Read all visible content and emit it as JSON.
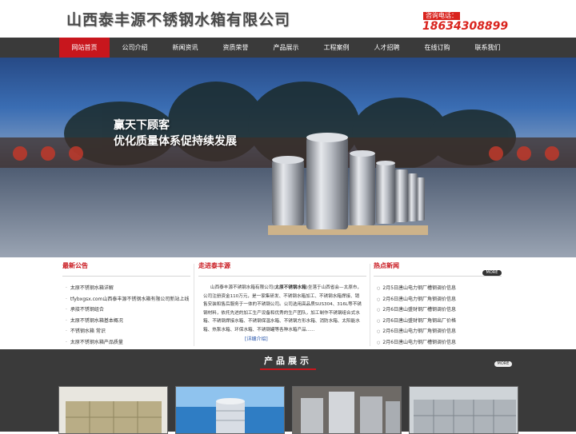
{
  "header": {
    "company_name": "山西泰丰源不锈钢水箱有限公司",
    "hotline_label": "咨询电话：",
    "hotline_number": "18634308899"
  },
  "nav": {
    "items": [
      {
        "label": "网站首页",
        "active": true
      },
      {
        "label": "公司介绍",
        "active": false
      },
      {
        "label": "新闻资讯",
        "active": false
      },
      {
        "label": "资质荣誉",
        "active": false
      },
      {
        "label": "产品展示",
        "active": false
      },
      {
        "label": "工程案例",
        "active": false
      },
      {
        "label": "人才招聘",
        "active": false
      },
      {
        "label": "在线订购",
        "active": false
      },
      {
        "label": "联系我们",
        "active": false
      }
    ]
  },
  "banner": {
    "slogan_line1": "赢天下顾客",
    "slogan_line2": "优化质量体系促持续发展"
  },
  "notices": {
    "title": "最新公告",
    "items": [
      "太原不锈钢水箱详解",
      "tfybxgsx.com山西泰丰源不锈钢水箱有限公司新站上线",
      "承接不锈钢组合",
      "太原不锈钢水箱基本概况",
      "不锈钢水箱 常识",
      "太原不锈钢水箱产品质量"
    ]
  },
  "about": {
    "title": "走进泰丰源",
    "text_before": "山西泰丰源不锈钢水箱有限公司(",
    "text_bold": "太原不锈钢水箱",
    "text_after": ")坐落于山西省会—太原市，公司注册资金110万元，是一家集研发、不锈钢水箱加工、不锈钢水箱焊接、销售安装和售后服务于一体的不锈钢公司。公司选用高品质SUS304、316L等不锈钢材料，依托先进的加工生产设备和优秀的生产团队，加工制作不锈钢组合式水箱、不锈钢焊接水箱、不锈钢保温水箱、不锈钢方形水箱、消防水箱、太阳能水箱、热泵水箱、环保水箱、不锈钢罐等各种水箱产品......",
    "more": "[详细介绍]"
  },
  "hot_news": {
    "title": "热点新闻",
    "more": "MORE",
    "items": [
      "2月5日唐山电力钢厂槽钢调价信息",
      "2月6日唐山电力钢厂角钢调价信息",
      "2月6日唐山盛财钢厂槽钢调价信息",
      "2月6日唐山盛财钢厂角钢出厂价格",
      "2月6日唐山电力钢厂角钢调价信息",
      "2月6日唐山电力钢厂槽钢调价信息"
    ]
  },
  "products": {
    "title": "产品展示",
    "more": "MORE"
  },
  "colors": {
    "brand_red": "#c8161d",
    "nav_dark": "#3a3a3a",
    "link_blue": "#1f4fa8"
  }
}
